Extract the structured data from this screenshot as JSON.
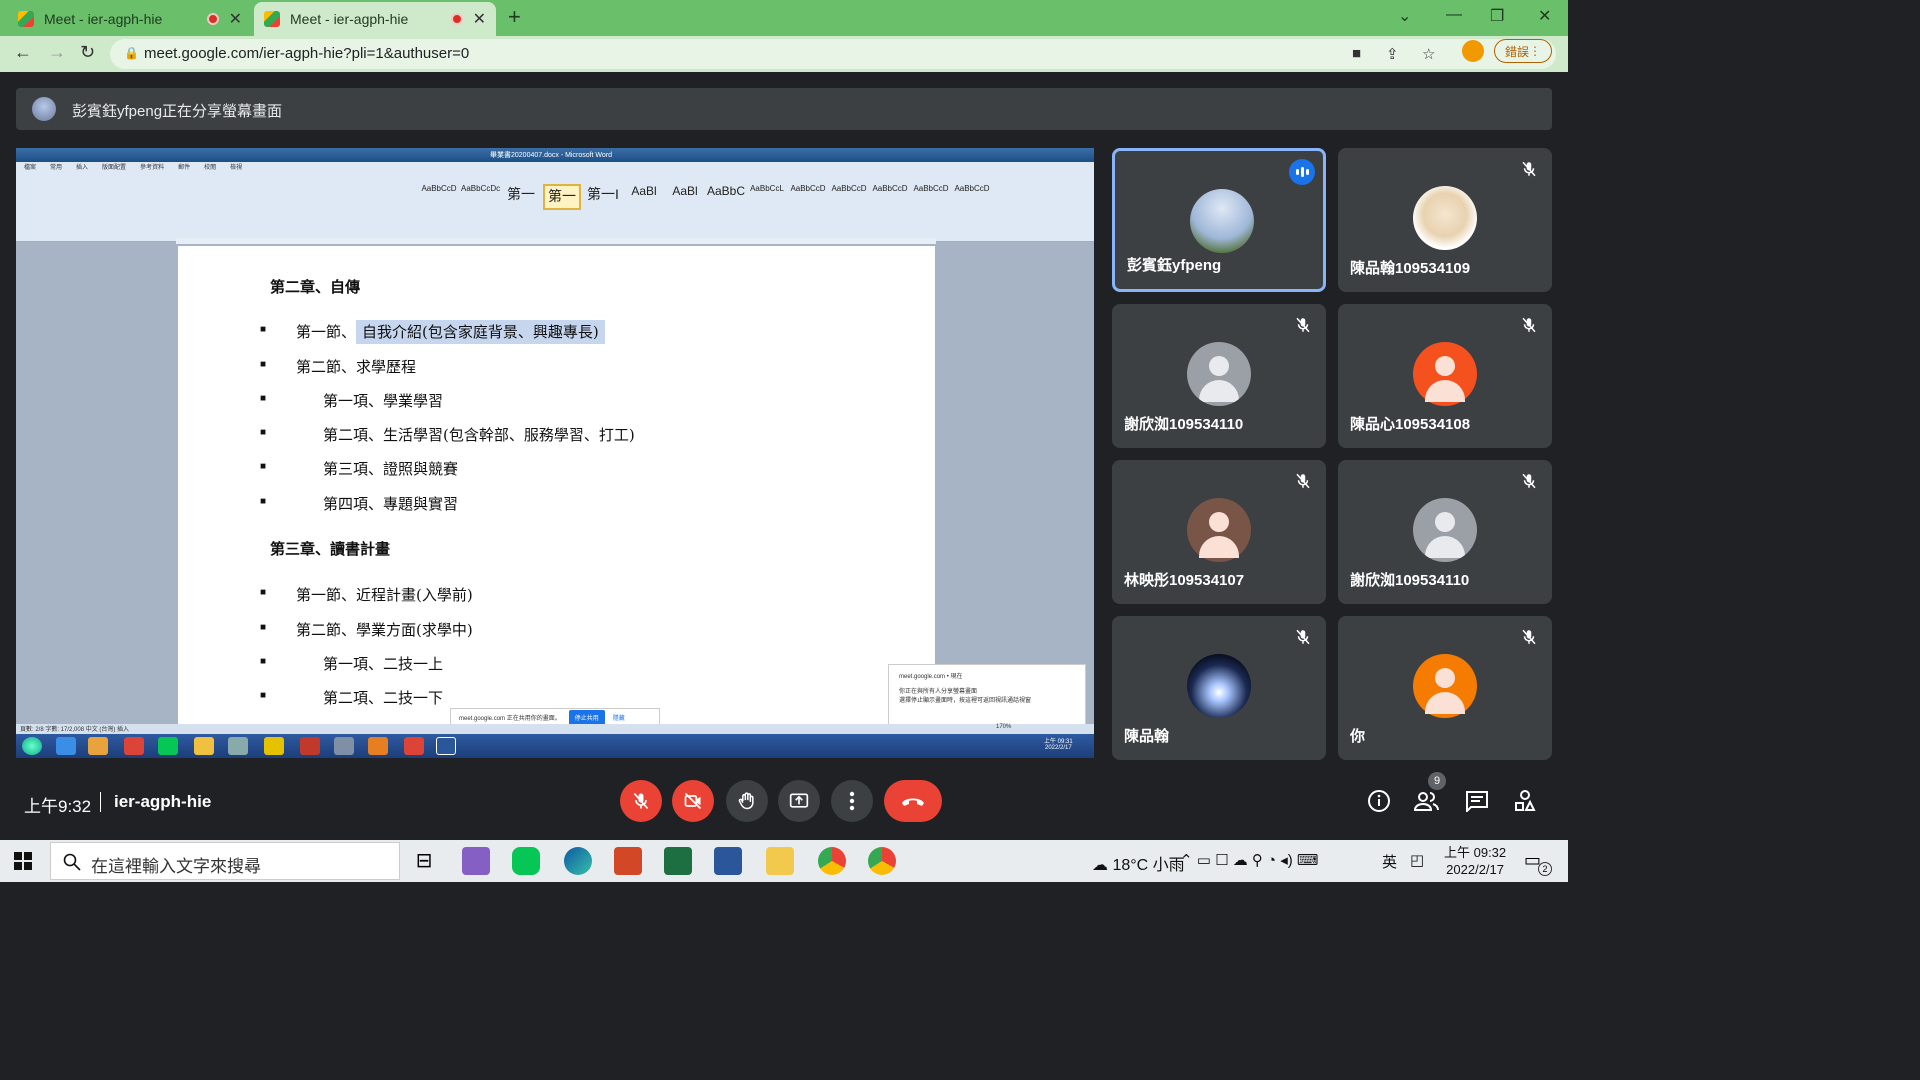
{
  "browser": {
    "tabs": [
      {
        "title": "Meet - ier-agph-hie",
        "active": false
      },
      {
        "title": "Meet - ier-agph-hie",
        "active": true
      }
    ],
    "url": "meet.google.com/ier-agph-hie?pli=1&authuser=0",
    "error_button": "錯誤"
  },
  "banner": {
    "text": "彭賓鈺yfpeng正在分享螢幕畫面"
  },
  "shared_screen": {
    "word_title": "畢業書20200407.docx - Microsoft Word",
    "ribbon_tabs": [
      "檔案",
      "常用",
      "插入",
      "版面配置",
      "參考資料",
      "郵件",
      "校閱",
      "檢視"
    ],
    "styles": [
      "AaBbCcD",
      "AaBbCcDc",
      "第一",
      "第一",
      "第一I",
      "AaBl",
      "AaBl",
      "AaBbC",
      "AaBbCcL",
      "AaBbCcD",
      "AaBbCcD",
      "AaBbCcD",
      "AaBbCcD",
      "AaBbCcD"
    ],
    "doc_lines": [
      {
        "text": "第二章、自傳",
        "indent": 0,
        "type": "chapter"
      },
      {
        "text": "第一節、",
        "hl": "自我介紹(包含家庭背景、興趣專長)",
        "indent": 1,
        "type": "item"
      },
      {
        "text": "第二節、求學歷程",
        "indent": 1,
        "type": "item"
      },
      {
        "text": "第一項、學業學習",
        "indent": 2,
        "type": "item"
      },
      {
        "text": "第二項、生活學習(包含幹部、服務學習、打工)",
        "indent": 2,
        "type": "item"
      },
      {
        "text": "第三項、證照與競賽",
        "indent": 2,
        "type": "item"
      },
      {
        "text": "第四項、專題與實習",
        "indent": 2,
        "type": "item"
      },
      {
        "text": "第三章、讀書計畫",
        "indent": 0,
        "type": "chapter"
      },
      {
        "text": "第一節、近程計畫(入學前)",
        "indent": 1,
        "type": "item"
      },
      {
        "text": "第二節、學業方面(求學中)",
        "indent": 1,
        "type": "item"
      },
      {
        "text": "第一項、二技一上",
        "indent": 2,
        "type": "item"
      },
      {
        "text": "第二項、二技一下",
        "indent": 2,
        "type": "item"
      }
    ],
    "status_text": "頁數: 2/8    字數: 17/2,008    中文 (台灣)    插入",
    "zoom": "170%",
    "notif_site": "meet.google.com • 現在",
    "notif_text": "你正在與所有人分享螢幕畫面",
    "notif_sub": "選擇停止顯示畫面時，按這裡可返回視訊通話視窗",
    "share_bar_text": "meet.google.com 正在共用你的畫面。",
    "share_bar_stop": "停止共用",
    "share_bar_hide": "隱藏",
    "inner_clock_time": "上午 09:31",
    "inner_clock_date": "2022/2/17"
  },
  "participants": [
    {
      "name": "彭賓鈺yfpeng",
      "muted": false,
      "speaking": true,
      "avatar": "photo-tower",
      "active": true
    },
    {
      "name": "陳品翰109534109",
      "muted": true,
      "avatar": "photo-dog"
    },
    {
      "name": "謝欣洳109534110",
      "muted": true,
      "avatar": "generic-gray"
    },
    {
      "name": "陳品心109534108",
      "muted": true,
      "avatar": "generic-orange"
    },
    {
      "name": "林映彤109534107",
      "muted": true,
      "avatar": "generic-brown"
    },
    {
      "name": "謝欣洳109534110",
      "muted": true,
      "avatar": "generic-gray"
    },
    {
      "name": "陳品翰",
      "muted": true,
      "avatar": "photo-light"
    },
    {
      "name": "你",
      "muted": true,
      "avatar": "generic-orange2"
    }
  ],
  "meeting": {
    "time": "上午9:32",
    "code": "ier-agph-hie",
    "people_count": "9"
  },
  "taskbar": {
    "search_placeholder": "在這裡輸入文字來搜尋",
    "weather": "18°C  小雨",
    "ime": "英",
    "clock_time": "上午 09:32",
    "clock_date": "2022/2/17",
    "notif_count": "2"
  },
  "colors": {
    "meet_bg": "#202124",
    "tile_bg": "#3c4043",
    "red": "#ea4335",
    "active_border": "#8ab4f8",
    "chrome_tab": "#6abf6a"
  }
}
